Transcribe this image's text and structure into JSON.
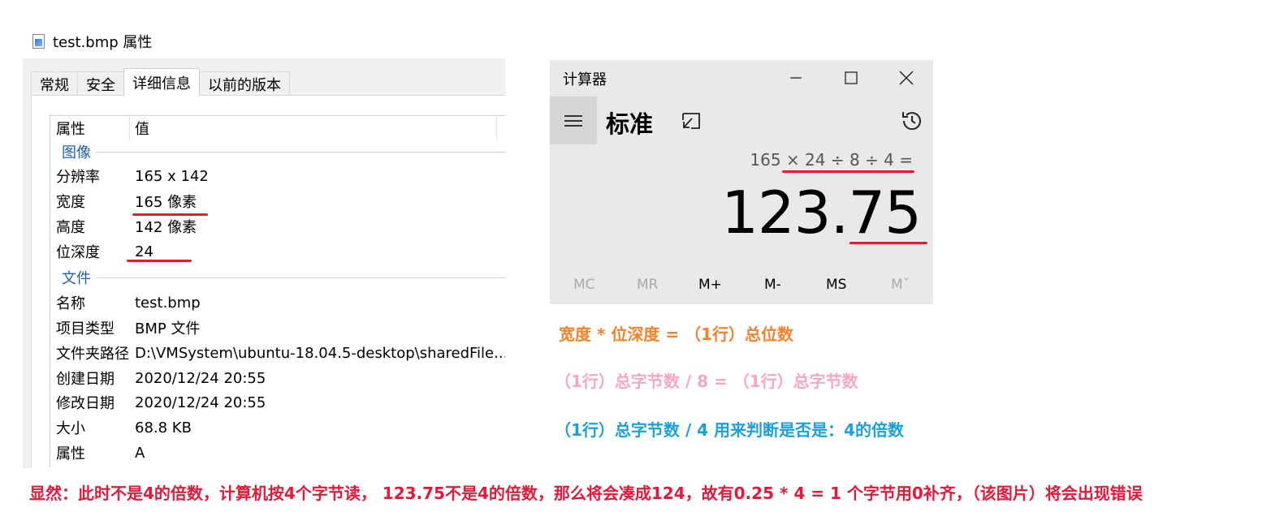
{
  "properties_window": {
    "title": "test.bmp 属性",
    "tabs": [
      {
        "label": "常规",
        "active": false
      },
      {
        "label": "安全",
        "active": false
      },
      {
        "label": "详细信息",
        "active": true
      },
      {
        "label": "以前的版本",
        "active": false
      }
    ],
    "columns": {
      "property": "属性",
      "value": "值"
    },
    "groups": {
      "image": {
        "label": "图像",
        "rows": [
          {
            "key": "分辨率",
            "value": "165 x 142"
          },
          {
            "key": "宽度",
            "value": "165 像素"
          },
          {
            "key": "高度",
            "value": "142 像素"
          },
          {
            "key": "位深度",
            "value": "24"
          }
        ]
      },
      "file": {
        "label": "文件",
        "rows": [
          {
            "key": "名称",
            "value": "test.bmp"
          },
          {
            "key": "项目类型",
            "value": "BMP 文件"
          },
          {
            "key": "文件夹路径",
            "value": "D:\\VMSystem\\ubuntu-18.04.5-desktop\\sharedFile..."
          },
          {
            "key": "创建日期",
            "value": "2020/12/24 20:55"
          },
          {
            "key": "修改日期",
            "value": "2020/12/24 20:55"
          },
          {
            "key": "大小",
            "value": "68.8 KB"
          },
          {
            "key": "属性",
            "value": "A"
          }
        ]
      }
    }
  },
  "calculator": {
    "title": "计算器",
    "mode": "标准",
    "expression": "165 × 24 ÷ 8 ÷ 4 =",
    "result": "123.75",
    "memory_buttons": [
      {
        "label": "MC",
        "enabled": false
      },
      {
        "label": "MR",
        "enabled": false
      },
      {
        "label": "M+",
        "enabled": true
      },
      {
        "label": "M-",
        "enabled": true
      },
      {
        "label": "MS",
        "enabled": true
      },
      {
        "label": "Mˇ",
        "enabled": false
      }
    ]
  },
  "annotations": {
    "note1": "宽度 * 位深度 = （1行）总位数",
    "note2": "（1行）总字节数 / 8 = （1行）总字节数",
    "note3": "（1行）总字节数 / 4  用来判断是否是：4的倍数",
    "footer": "显然：此时不是4的倍数，计算机按4个字节读， 123.75不是4的倍数，那么将会凑成124，故有0.25 * 4 = 1 个字节用0补齐，（该图片）将会出现错误"
  },
  "colors": {
    "note1": "#f5822a",
    "note2": "#f7a6c4",
    "note3": "#1ba0dc",
    "footer": "#e4193a",
    "underline": "#e21d2e",
    "group_label": "#1e5fb4"
  }
}
